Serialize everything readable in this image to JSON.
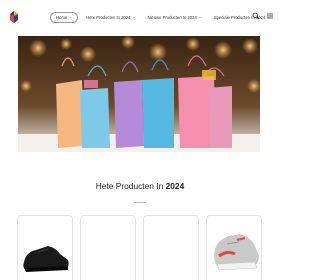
{
  "header": {
    "logo": "site-logo",
    "nav": [
      {
        "label": "Home",
        "active": true
      },
      {
        "label": "Hete Producten In 2024",
        "active": false
      },
      {
        "label": "Nieuwe Producten In 2024",
        "active": false
      },
      {
        "label": "Speciale Producten In 2024",
        "active": false
      }
    ],
    "icons": [
      "search-icon",
      "menu-icon"
    ]
  },
  "hero": {
    "image": "colorful-shopping-bags-photo",
    "bag_colors": [
      "#f5b780",
      "#7ec8e8",
      "#b58ad8",
      "#55b8e0",
      "#f58fb0",
      "#e89ab8"
    ]
  },
  "section": {
    "title_prefix": "Hete Producten In ",
    "title_year": "2024"
  },
  "products": [
    {
      "image": "black-sneaker"
    },
    {
      "image": "blank"
    },
    {
      "image": "blank"
    },
    {
      "image": "grey-red-sneaker"
    }
  ]
}
